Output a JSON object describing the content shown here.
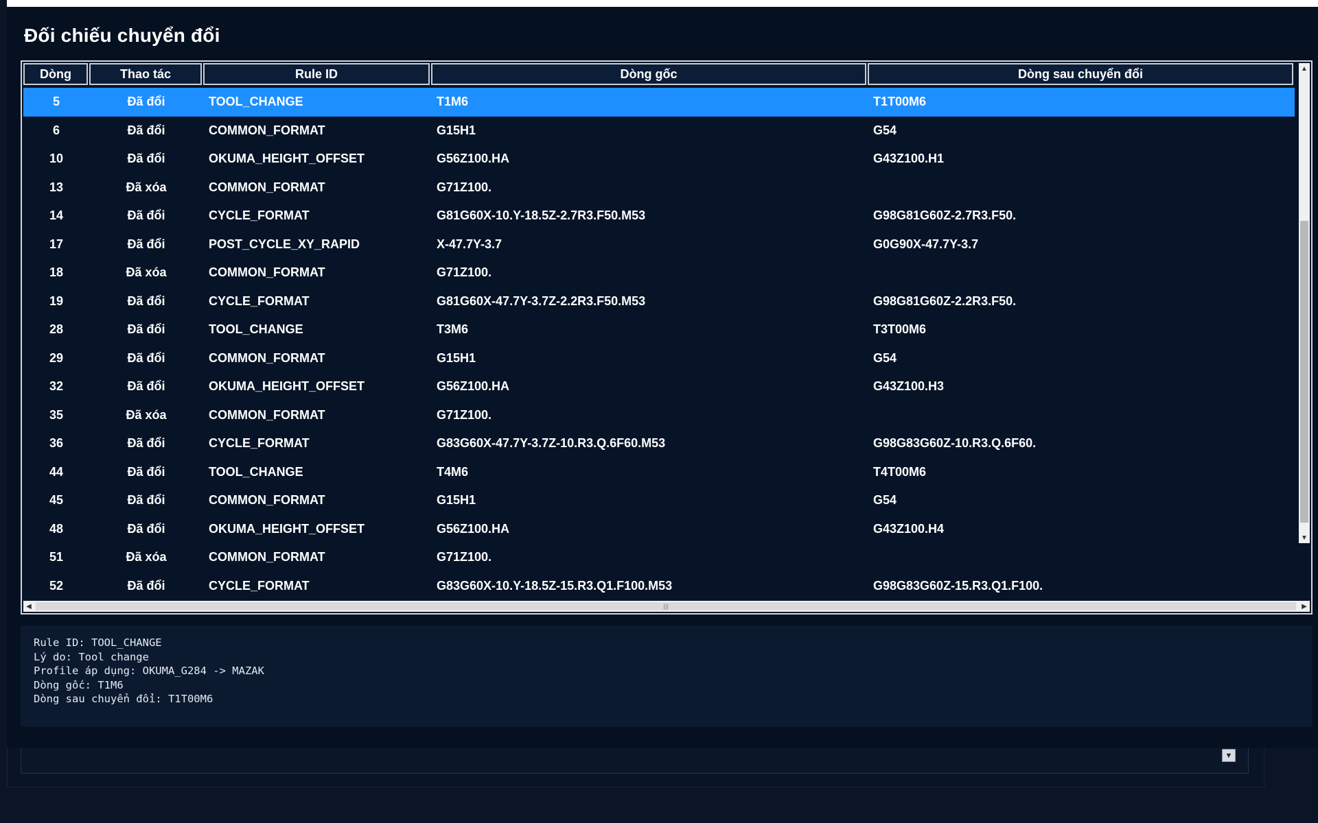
{
  "title": "Đối chiếu chuyển đổi",
  "table": {
    "columns": [
      "Dòng",
      "Thao tác",
      "Rule ID",
      "Dòng gốc",
      "Dòng sau chuyển đổi"
    ],
    "selected_index": 0,
    "rows": [
      {
        "line": "5",
        "action": "Đã đổi",
        "rule": "TOOL_CHANGE",
        "original": "T1M6",
        "converted": "T1T00M6"
      },
      {
        "line": "6",
        "action": "Đã đổi",
        "rule": "COMMON_FORMAT",
        "original": "G15H1",
        "converted": "G54"
      },
      {
        "line": "10",
        "action": "Đã đổi",
        "rule": "OKUMA_HEIGHT_OFFSET",
        "original": "G56Z100.HA",
        "converted": "G43Z100.H1"
      },
      {
        "line": "13",
        "action": "Đã xóa",
        "rule": "COMMON_FORMAT",
        "original": "G71Z100.",
        "converted": ""
      },
      {
        "line": "14",
        "action": "Đã đổi",
        "rule": "CYCLE_FORMAT",
        "original": "G81G60X-10.Y-18.5Z-2.7R3.F50.M53",
        "converted": "G98G81G60Z-2.7R3.F50."
      },
      {
        "line": "17",
        "action": "Đã đổi",
        "rule": "POST_CYCLE_XY_RAPID",
        "original": "X-47.7Y-3.7",
        "converted": "G0G90X-47.7Y-3.7"
      },
      {
        "line": "18",
        "action": "Đã xóa",
        "rule": "COMMON_FORMAT",
        "original": "G71Z100.",
        "converted": ""
      },
      {
        "line": "19",
        "action": "Đã đổi",
        "rule": "CYCLE_FORMAT",
        "original": "G81G60X-47.7Y-3.7Z-2.2R3.F50.M53",
        "converted": "G98G81G60Z-2.2R3.F50."
      },
      {
        "line": "28",
        "action": "Đã đổi",
        "rule": "TOOL_CHANGE",
        "original": "T3M6",
        "converted": "T3T00M6"
      },
      {
        "line": "29",
        "action": "Đã đổi",
        "rule": "COMMON_FORMAT",
        "original": "G15H1",
        "converted": "G54"
      },
      {
        "line": "32",
        "action": "Đã đổi",
        "rule": "OKUMA_HEIGHT_OFFSET",
        "original": "G56Z100.HA",
        "converted": "G43Z100.H3"
      },
      {
        "line": "35",
        "action": "Đã xóa",
        "rule": "COMMON_FORMAT",
        "original": "G71Z100.",
        "converted": ""
      },
      {
        "line": "36",
        "action": "Đã đổi",
        "rule": "CYCLE_FORMAT",
        "original": "G83G60X-47.7Y-3.7Z-10.R3.Q.6F60.M53",
        "converted": "G98G83G60Z-10.R3.Q.6F60."
      },
      {
        "line": "44",
        "action": "Đã đổi",
        "rule": "TOOL_CHANGE",
        "original": "T4M6",
        "converted": "T4T00M6"
      },
      {
        "line": "45",
        "action": "Đã đổi",
        "rule": "COMMON_FORMAT",
        "original": "G15H1",
        "converted": "G54"
      },
      {
        "line": "48",
        "action": "Đã đổi",
        "rule": "OKUMA_HEIGHT_OFFSET",
        "original": "G56Z100.HA",
        "converted": "G43Z100.H4"
      },
      {
        "line": "51",
        "action": "Đã xóa",
        "rule": "COMMON_FORMAT",
        "original": "G71Z100.",
        "converted": ""
      },
      {
        "line": "52",
        "action": "Đã đổi",
        "rule": "CYCLE_FORMAT",
        "original": "G83G60X-10.Y-18.5Z-15.R3.Q1.F100.M53",
        "converted": "G98G83G60Z-15.R3.Q1.F100."
      }
    ]
  },
  "details": [
    "Rule ID: TOOL_CHANGE",
    "Lý do: Tool change",
    "Profile áp dụng: OKUMA_G284 -> MAZAK",
    "Dòng gốc: T1M6",
    "Dòng sau chuyển đổi: T1T00M6"
  ],
  "colors": {
    "background": "#0b1525",
    "selected_row": "#1e8fff",
    "header_bg": "#0c1d38"
  }
}
